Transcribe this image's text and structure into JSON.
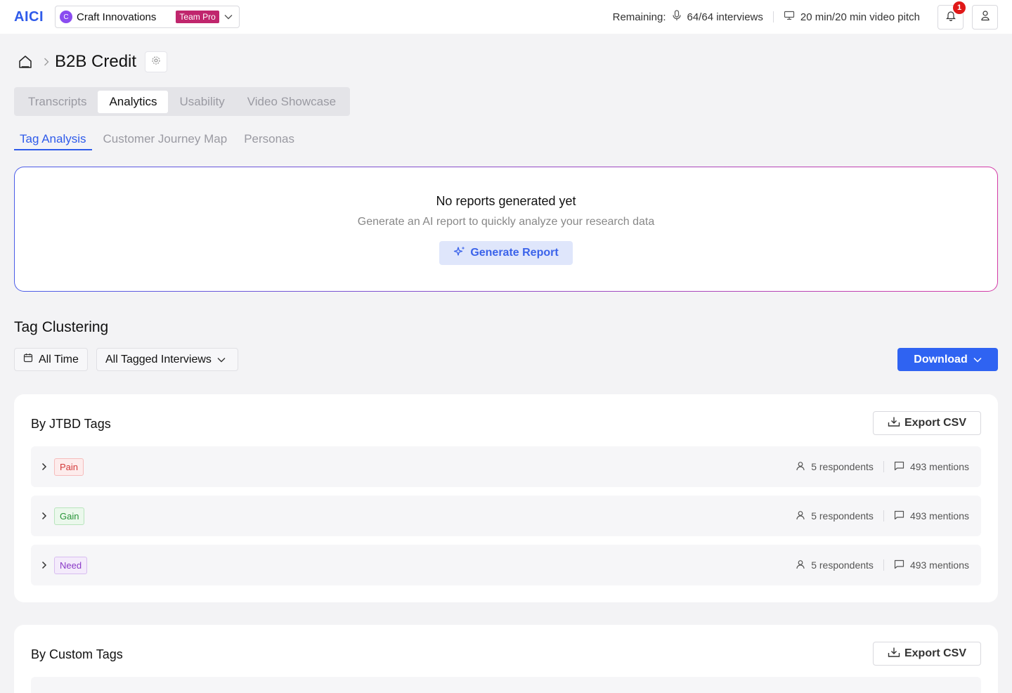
{
  "header": {
    "logo": "AICI",
    "org": {
      "initial": "C",
      "name": "Craft Innovations",
      "plan": "Team Pro"
    },
    "remaining_label": "Remaining:",
    "interviews": "64/64 interviews",
    "video": "20 min/20 min video pitch",
    "notification_count": "1"
  },
  "breadcrumb": {
    "title": "B2B Credit"
  },
  "main_tabs": [
    {
      "label": "Transcripts",
      "active": false
    },
    {
      "label": "Analytics",
      "active": true
    },
    {
      "label": "Usability",
      "active": false
    },
    {
      "label": "Video Showcase",
      "active": false
    }
  ],
  "sub_tabs": [
    {
      "label": "Tag Analysis",
      "active": true
    },
    {
      "label": "Customer Journey Map",
      "active": false
    },
    {
      "label": "Personas",
      "active": false
    }
  ],
  "report": {
    "title": "No reports generated yet",
    "subtitle": "Generate an AI report to quickly analyze your research data",
    "button": "Generate Report"
  },
  "clustering": {
    "title": "Tag Clustering",
    "time_filter": "All Time",
    "interview_filter": "All Tagged Interviews",
    "download": "Download"
  },
  "jtbd": {
    "title": "By JTBD Tags",
    "export": "Export CSV",
    "rows": [
      {
        "tag": "Pain",
        "respondents": "5 respondents",
        "mentions": "493 mentions"
      },
      {
        "tag": "Gain",
        "respondents": "5 respondents",
        "mentions": "493 mentions"
      },
      {
        "tag": "Need",
        "respondents": "5 respondents",
        "mentions": "493 mentions"
      }
    ]
  },
  "custom": {
    "title": "By Custom Tags",
    "export": "Export CSV"
  },
  "colors": {
    "accent": "#2f5bea",
    "plan_badge": "#c0266d",
    "notification": "#e01818",
    "pain": "#d33a3a",
    "gain": "#279438",
    "need": "#8a39c7"
  }
}
